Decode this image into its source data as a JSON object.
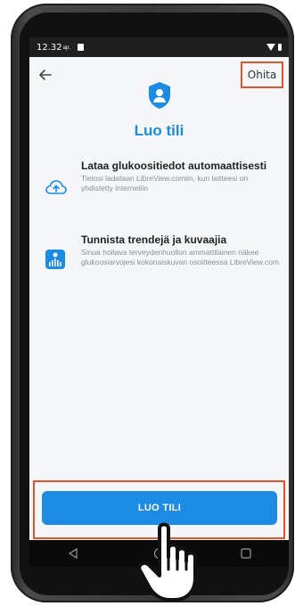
{
  "status_bar": {
    "time": "12.32",
    "ampm": "ap."
  },
  "header": {
    "skip_label": "Ohita"
  },
  "title": "Luo tili",
  "features": [
    {
      "icon": "cloud-upload-icon",
      "title": "Lataa glukoositiedot automaattisesti",
      "description": "Tietosi ladataan LibreView.comiin, kun laitteesi on yhdistetty internetiin"
    },
    {
      "icon": "trend-chart-icon",
      "title": "Tunnista trendejä ja kuvaajia",
      "description": "Sinua hoitava terveydenhuollon ammattilainen näkee glukoosiarvojesi kokonaiskuvan osoitteessa LibreView.com"
    }
  ],
  "cta": {
    "label": "LUO TILI"
  },
  "colors": {
    "accent": "#1b8be3",
    "highlight": "#e0552d",
    "title": "#1b8cd8"
  }
}
